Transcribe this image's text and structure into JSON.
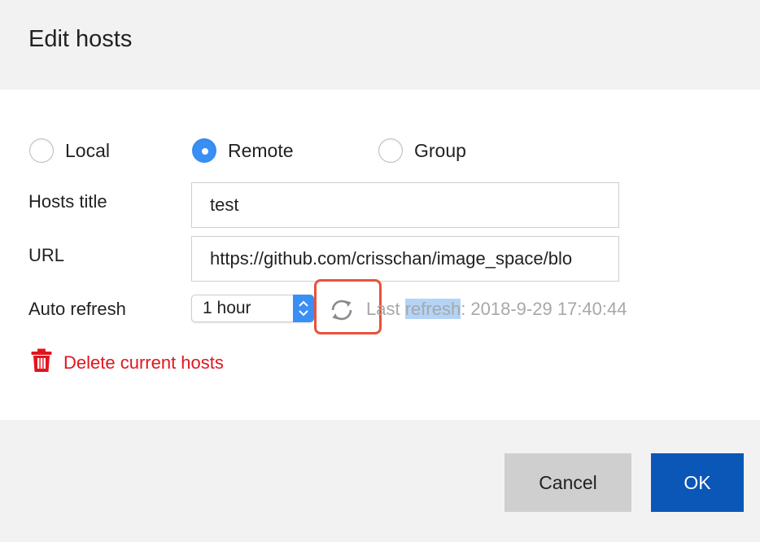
{
  "dialog": {
    "title": "Edit hosts"
  },
  "host_type": {
    "options": [
      {
        "label": "Local",
        "checked": false
      },
      {
        "label": "Remote",
        "checked": true
      },
      {
        "label": "Group",
        "checked": false
      }
    ]
  },
  "form": {
    "hosts_title_label": "Hosts title",
    "hosts_title_value": "test",
    "url_label": "URL",
    "url_value": "https://github.com/crisschan/image_space/blo",
    "auto_refresh_label": "Auto refresh",
    "auto_refresh_selected": "1 hour",
    "last_refresh_prefix": "Last ",
    "last_refresh_selected": "refresh",
    "last_refresh_suffix": ": 2018-9-29 17:40:44"
  },
  "actions": {
    "delete_label": "Delete current hosts",
    "cancel_label": "Cancel",
    "ok_label": "OK"
  },
  "colors": {
    "accent": "#3a8ff5",
    "danger": "#e0161e",
    "primary_button": "#0b57b8",
    "annotation": "#e8523a"
  },
  "icons": {
    "refresh": "refresh-icon",
    "trash": "trash-icon",
    "select_arrows": "chevron-updown-icon"
  }
}
